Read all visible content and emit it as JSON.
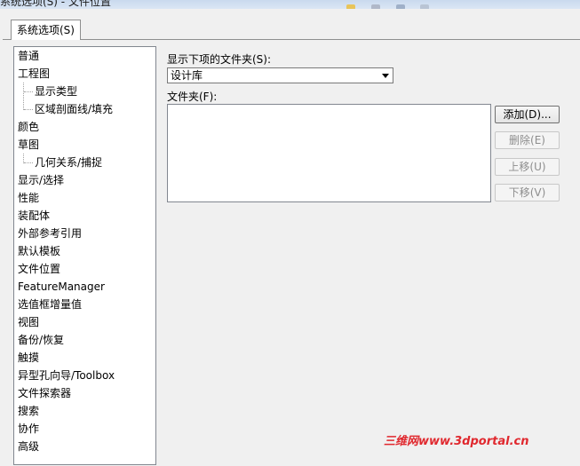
{
  "window": {
    "title": "系统选项(S) - 文件位置"
  },
  "tab": {
    "label": "系统选项(S)"
  },
  "tree": {
    "items": [
      {
        "label": "普通",
        "level": 0
      },
      {
        "label": "工程图",
        "level": 0
      },
      {
        "label": "显示类型",
        "level": 1
      },
      {
        "label": "区域剖面线/填充",
        "level": 1
      },
      {
        "label": "颜色",
        "level": 0
      },
      {
        "label": "草图",
        "level": 0
      },
      {
        "label": "几何关系/捕捉",
        "level": 1
      },
      {
        "label": "显示/选择",
        "level": 0
      },
      {
        "label": "性能",
        "level": 0
      },
      {
        "label": "装配体",
        "level": 0
      },
      {
        "label": "外部参考引用",
        "level": 0
      },
      {
        "label": "默认模板",
        "level": 0
      },
      {
        "label": "文件位置",
        "level": 0,
        "selected": true
      },
      {
        "label": "FeatureManager",
        "level": 0
      },
      {
        "label": "选值框增量值",
        "level": 0
      },
      {
        "label": "视图",
        "level": 0
      },
      {
        "label": "备份/恢复",
        "level": 0
      },
      {
        "label": "触摸",
        "level": 0
      },
      {
        "label": "异型孔向导/Toolbox",
        "level": 0
      },
      {
        "label": "文件探索器",
        "level": 0
      },
      {
        "label": "搜索",
        "level": 0
      },
      {
        "label": "协作",
        "level": 0
      },
      {
        "label": "高级",
        "level": 0
      }
    ]
  },
  "folders_for": {
    "label": "显示下项的文件夹(S):",
    "selected": "设计库"
  },
  "folders": {
    "label": "文件夹(F):",
    "items": []
  },
  "buttons": {
    "add": "添加(D)...",
    "delete": "删除(E)",
    "move_up": "上移(U)",
    "move_down": "下移(V)"
  },
  "watermark": "三维网www.3dportal.cn"
}
